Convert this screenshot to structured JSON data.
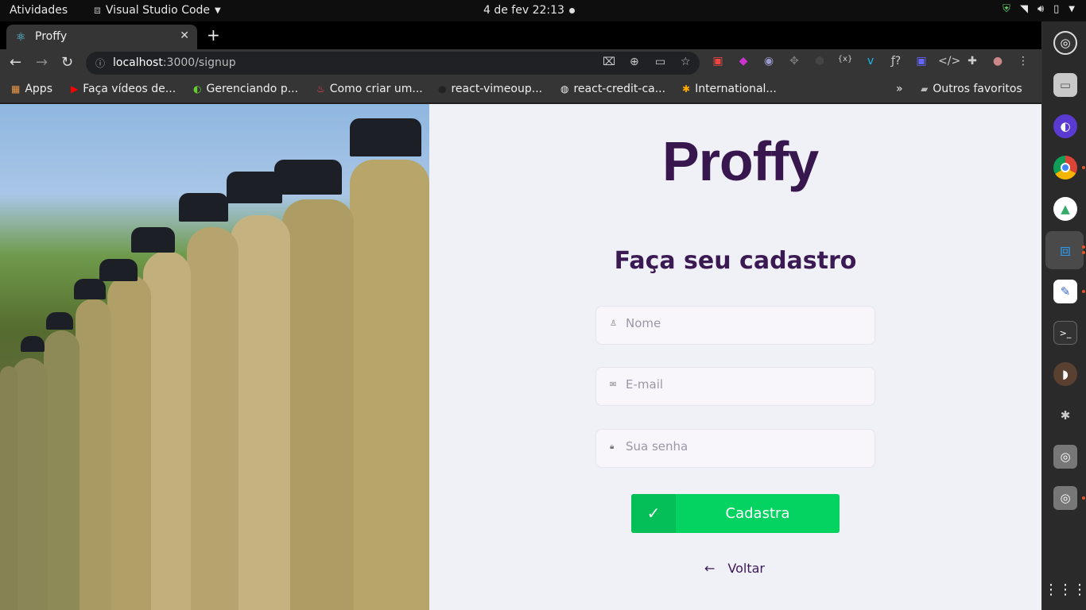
{
  "system": {
    "activities": "Atividades",
    "app_name": "Visual Studio Code",
    "clock": "4 de fev  22:13"
  },
  "browser": {
    "tab_title": "Proffy",
    "url_host": "localhost",
    "url_path": ":3000/signup",
    "bookmarks": [
      {
        "label": "Apps",
        "icon": "apps-grid-icon"
      },
      {
        "label": "Faça vídeos de...",
        "icon": "youtube-icon"
      },
      {
        "label": "Gerenciando p...",
        "icon": "app-icon"
      },
      {
        "label": "Como criar um...",
        "icon": "fire-icon"
      },
      {
        "label": "react-vimeoup...",
        "icon": "github-icon"
      },
      {
        "label": "react-credit-ca...",
        "icon": "globe-icon"
      },
      {
        "label": "International...",
        "icon": "nbc-icon"
      }
    ],
    "other_bookmarks": "Outros favoritos"
  },
  "page": {
    "logo": "Proffy",
    "title": "Faça seu cadastro",
    "fields": {
      "name_placeholder": "Nome",
      "email_placeholder": "E-mail",
      "password_placeholder": "Sua senha"
    },
    "submit_label": "Cadastra",
    "back_label": "Voltar"
  },
  "colors": {
    "primary": "#37174d",
    "accent_green": "#04d361",
    "background": "#f0f0f7"
  }
}
